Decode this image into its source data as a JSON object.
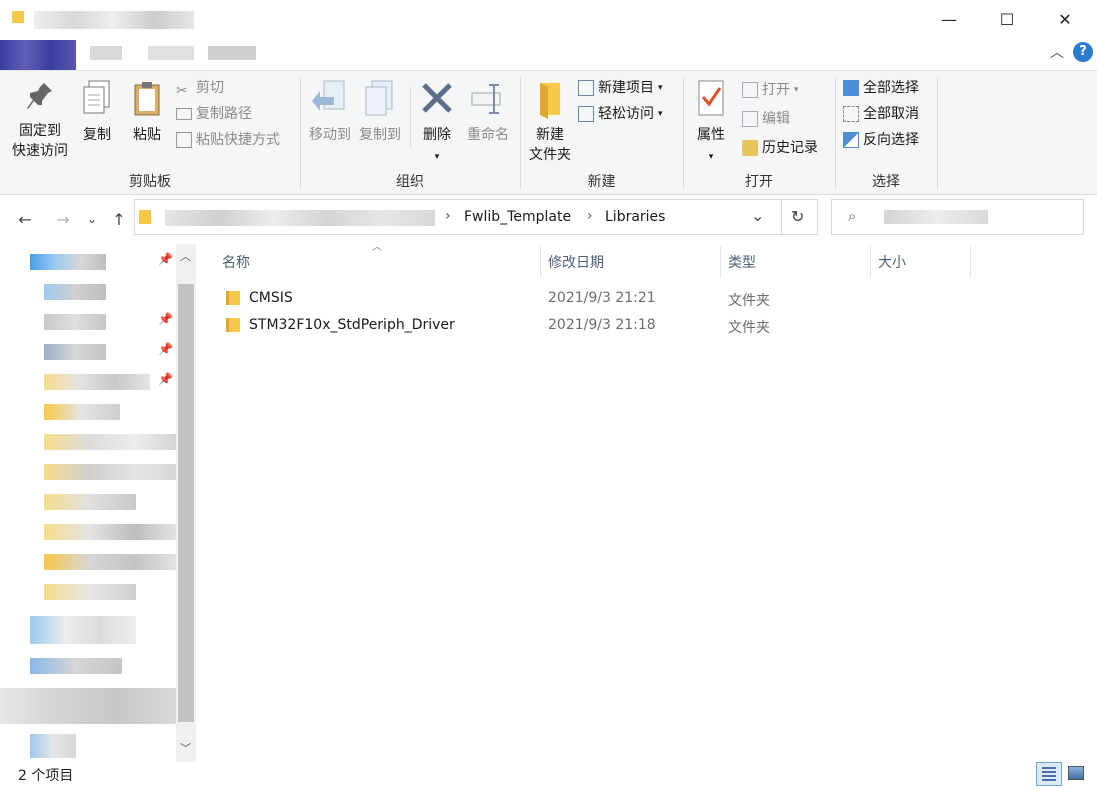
{
  "window": {
    "minimize_label": "—",
    "maximize_label": "☐",
    "close_label": "✕",
    "help_label": "?"
  },
  "ribbon": {
    "clipboard": {
      "group_label": "剪贴板",
      "pin_label_1": "固定到",
      "pin_label_2": "快速访问",
      "copy_label": "复制",
      "paste_label": "粘贴",
      "cut_label": "剪切",
      "copy_path_label": "复制路径",
      "paste_shortcut_label": "粘贴快捷方式"
    },
    "organize": {
      "group_label": "组织",
      "move_to_label": "移动到",
      "copy_to_label": "复制到",
      "delete_label": "删除",
      "rename_label": "重命名"
    },
    "new": {
      "group_label": "新建",
      "new_folder_label_1": "新建",
      "new_folder_label_2": "文件夹",
      "new_item_label": "新建项目",
      "easy_access_label": "轻松访问"
    },
    "open": {
      "group_label": "打开",
      "properties_label": "属性",
      "open_label": "打开",
      "edit_label": "编辑",
      "history_label": "历史记录"
    },
    "select": {
      "group_label": "选择",
      "select_all_label": "全部选择",
      "select_none_label": "全部取消",
      "invert_label": "反向选择"
    }
  },
  "address": {
    "crumbs": [
      "Fwlib_Template",
      "Libraries"
    ],
    "separator": "›"
  },
  "columns": {
    "name": "名称",
    "modified": "修改日期",
    "type": "类型",
    "size": "大小"
  },
  "files": [
    {
      "name": "CMSIS",
      "modified": "2021/9/3 21:21",
      "type": "文件夹",
      "size": ""
    },
    {
      "name": "STM32F10x_StdPeriph_Driver",
      "modified": "2021/9/3 21:18",
      "type": "文件夹",
      "size": ""
    }
  ],
  "status": {
    "count": "2 个项目"
  },
  "colors": {
    "accent": "#2b7bd3",
    "folder": "#f7c948",
    "header_text": "#4c607a"
  }
}
